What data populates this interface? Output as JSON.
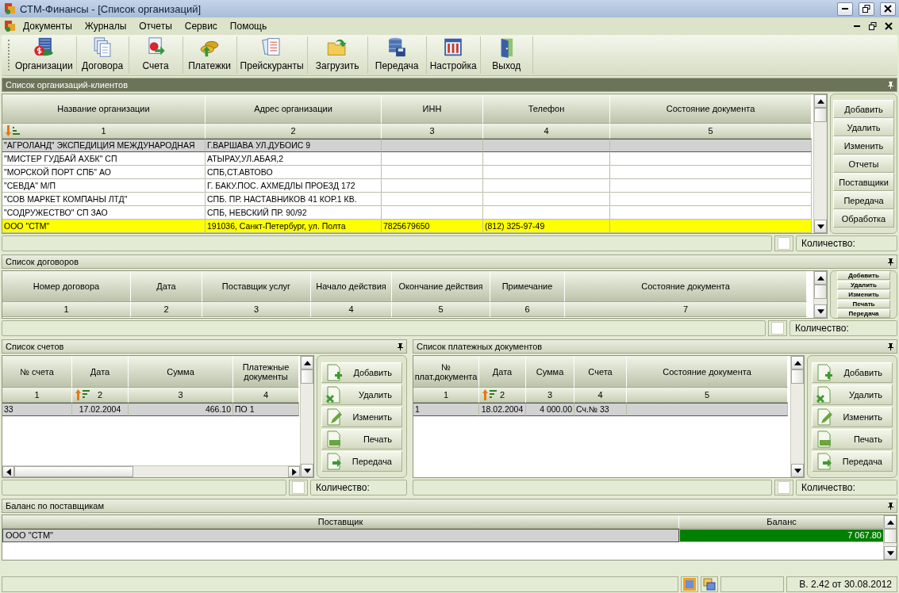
{
  "window": {
    "title": "СТМ-Финансы - [Список организаций]"
  },
  "menu": [
    "Документы",
    "Журналы",
    "Отчеты",
    "Сервис",
    "Помощь"
  ],
  "toolbar": [
    "Организации",
    "Договора",
    "Счета",
    "Платежки",
    "Прейскуранты",
    "Загрузить",
    "Передача",
    "Настройка",
    "Выход"
  ],
  "organizations": {
    "title": "Список организаций-клиентов",
    "active": true,
    "columns": [
      {
        "label": "Название организации",
        "number": "1",
        "kind": "sort-desc"
      },
      {
        "label": "Адрес организации",
        "number": "2",
        "kind": "plain"
      },
      {
        "label": "ИНН",
        "number": "3",
        "kind": "plain"
      },
      {
        "label": "Телефон",
        "number": "4",
        "kind": "plain"
      },
      {
        "label": "Состояние документа",
        "number": "5",
        "kind": "plain"
      }
    ],
    "rows": [
      {
        "cells": [
          "\"АГРОЛАНД\" ЭКСПЕДИЦИЯ МЕЖДУНАРОДНАЯ",
          "Г.ВАРШАВА УЛ.ДУБОИС 9",
          "",
          "",
          ""
        ],
        "selected": true,
        "highlighted": false
      },
      {
        "cells": [
          "\"МИСТЕР ГУДБАЙ АХБК\" СП",
          "АТЫРАУ,УЛ.АБАЯ,2",
          "",
          "",
          ""
        ],
        "selected": false,
        "highlighted": false
      },
      {
        "cells": [
          "\"МОРСКОЙ ПОРТ СПБ\" АО",
          "СПБ,СТ.АВТОВО",
          "",
          "",
          ""
        ],
        "selected": false,
        "highlighted": false
      },
      {
        "cells": [
          "\"СЕВДА\" М/П",
          "Г. БАКУ.ПОС. АХМЕДЛЫ ПРОЕЗД 172",
          "",
          "",
          ""
        ],
        "selected": false,
        "highlighted": false
      },
      {
        "cells": [
          "\"СОВ МАРКЕТ КОМПАНЫ ЛТД\"",
          "СПБ. ПР. НАСТАВНИКОВ 41 КОР.1 КВ.",
          "",
          "",
          ""
        ],
        "selected": false,
        "highlighted": false
      },
      {
        "cells": [
          "\"СОДРУЖЕСТВО\" СП ЗАО",
          "СПБ, НЕВСКИЙ ПР. 90/92",
          "",
          "",
          ""
        ],
        "selected": false,
        "highlighted": false
      },
      {
        "cells": [
          "ООО \"СТМ\"",
          "191036, Санкт-Петербург, ул. Полта",
          "7825679650",
          "(812) 325-97-49",
          ""
        ],
        "selected": false,
        "highlighted": true
      }
    ],
    "side_buttons": [
      {
        "label": "Добавить",
        "kind": "plain"
      },
      {
        "label": "Удалить",
        "kind": "plain"
      },
      {
        "label": "Изменить",
        "kind": "plain"
      },
      {
        "label": "Отчеты",
        "kind": "plain"
      },
      {
        "label": "Поставщики",
        "kind": "plain"
      },
      {
        "label": "Передача",
        "kind": "plain"
      },
      {
        "label": "Обработка",
        "kind": "plain"
      }
    ],
    "count_label": "Количество:"
  },
  "contracts": {
    "title": "Список договоров",
    "active": false,
    "columns": [
      {
        "label": "Номер договора",
        "number": "1"
      },
      {
        "label": "Дата",
        "number": "2"
      },
      {
        "label": "Поставщик услуг",
        "number": "3"
      },
      {
        "label": "Начало действия",
        "number": "4"
      },
      {
        "label": "Окончание действия",
        "number": "5"
      },
      {
        "label": "Примечание",
        "number": "6"
      },
      {
        "label": "Состояние документа",
        "number": "7"
      }
    ],
    "side_buttons": [
      {
        "label": "Добавить",
        "kind": "mini"
      },
      {
        "label": "Удалить",
        "kind": "mini"
      },
      {
        "label": "Изменить",
        "kind": "mini"
      },
      {
        "label": "Печать",
        "kind": "mini"
      },
      {
        "label": "Передача",
        "kind": "mini"
      }
    ],
    "count_label": "Количество:"
  },
  "invoices": {
    "title": "Список счетов",
    "active": false,
    "columns": [
      {
        "label": "№ счета",
        "number": "1",
        "kind": "plain"
      },
      {
        "label": "Дата",
        "number": "2",
        "kind": "sort-asc"
      },
      {
        "label": "Сумма",
        "number": "3",
        "kind": "plain"
      },
      {
        "label": "Платежные документы",
        "number": "4",
        "kind": "plain"
      }
    ],
    "rows": [
      {
        "cells": [
          "33",
          "17.02.2004",
          "466.10",
          "ПО 1"
        ],
        "selected": true,
        "highlighted": false
      }
    ],
    "side_buttons": [
      {
        "label": "Добавить",
        "kind": "icon"
      },
      {
        "label": "Удалить",
        "kind": "icon"
      },
      {
        "label": "Изменить",
        "kind": "icon"
      },
      {
        "label": "Печать",
        "kind": "icon"
      },
      {
        "label": "Передача",
        "kind": "icon"
      }
    ],
    "count_label": "Количество:"
  },
  "payments": {
    "title": "Список платежных документов",
    "active": false,
    "columns": [
      {
        "label": "№ плат.документа",
        "number": "1",
        "kind": "plain"
      },
      {
        "label": "Дата",
        "number": "2",
        "kind": "sort-asc"
      },
      {
        "label": "Сумма",
        "number": "3",
        "kind": "plain"
      },
      {
        "label": "Счета",
        "number": "4",
        "kind": "plain"
      },
      {
        "label": "Состояние документа",
        "number": "5",
        "kind": "plain"
      }
    ],
    "rows": [
      {
        "cells": [
          "1",
          "18.02.2004",
          "4 000.00",
          "Сч.№ 33",
          ""
        ],
        "selected": true,
        "highlighted": false
      }
    ],
    "side_buttons": [
      {
        "label": "Добавить",
        "kind": "icon"
      },
      {
        "label": "Удалить",
        "kind": "icon"
      },
      {
        "label": "Изменить",
        "kind": "icon"
      },
      {
        "label": "Печать",
        "kind": "icon"
      },
      {
        "label": "Передача",
        "kind": "icon"
      }
    ],
    "count_label": "Количество:"
  },
  "balance": {
    "title": "Баланс по поставщикам",
    "active": false,
    "columns": [
      "Поставщик",
      "Баланс"
    ],
    "rows": [
      {
        "supplier": "ООО \"СТМ\"",
        "amount": "7 067.80",
        "color": "#008000",
        "selected": true
      }
    ]
  },
  "status_bar": {
    "version": "В. 2.42 от 30.08.2012"
  }
}
